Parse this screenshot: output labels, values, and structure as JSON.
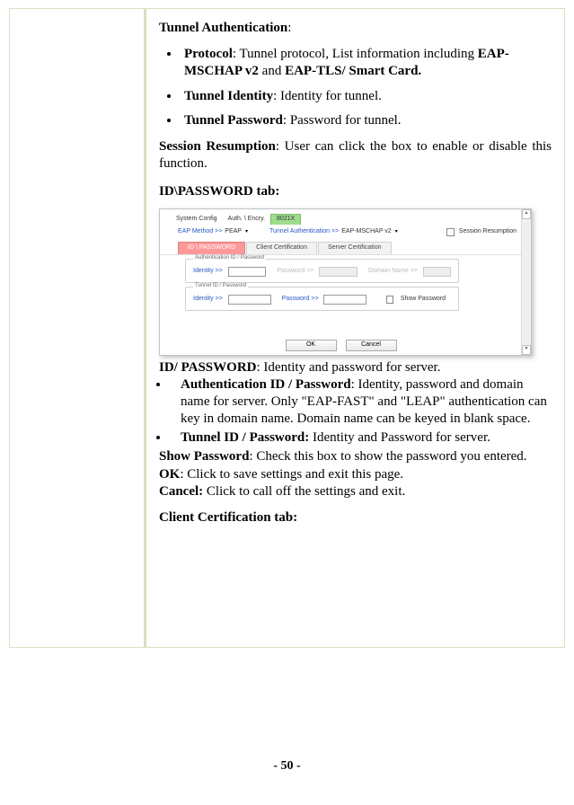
{
  "tunnel_auth": {
    "head": "Tunnel Authentication",
    "protocol_label": "Protocol",
    "protocol_desc_part1": ": Tunnel protocol, List information including ",
    "protocol_val1": "EAP-MSCHAP v2",
    "protocol_and": " and ",
    "protocol_val2": "EAP-TLS/ Smart Card.",
    "identity_label": "Tunnel Identity",
    "identity_desc": ": Identity for tunnel.",
    "password_label": "Tunnel Password",
    "password_desc": ": Password for tunnel."
  },
  "session_resumption": {
    "label": "Session Resumption",
    "desc": ": User can click the box to enable or disable this function."
  },
  "idpw": {
    "tab_head": "ID\\PASSWORD tab:",
    "head_label": "ID/ PASSWORD",
    "head_desc": ": Identity and password for server.",
    "auth_label": "Authentication ID / Password",
    "auth_desc": ": Identity, password and domain name for server. Only \"EAP-FAST\" and \"LEAP\" authentication can key in domain name. Domain name can be keyed in blank space.",
    "tun_label": "Tunnel ID / Password:",
    "tun_desc": " Identity and Password for server.",
    "showpw_label": "Show Password",
    "showpw_desc": ": Check this box to show the password you entered.",
    "ok_label": "OK",
    "ok_desc": ": Click to save settings and exit this page.",
    "cancel_label": "Cancel:",
    "cancel_desc": " Click to call off the settings and exit.",
    "clientcert_head": "Client Certification tab:"
  },
  "mini": {
    "tabs1": {
      "system": "System Config",
      "auth": "Auth. \\ Encry.",
      "x": "8021X"
    },
    "eap_lbl": "EAP Method >>",
    "eap_val": "PEAP",
    "tun_lbl": "Tunnel Authentication >>",
    "tun_val": "EAP-MSCHAP v2",
    "sess": "Session Resumption",
    "tabs2": {
      "idpw": "ID \\ PASSWORD",
      "client": "Client Certification",
      "server": "Server Certification"
    },
    "grp1": "Authentication ID / Password",
    "grp2": "Tunnel ID / Password",
    "identity": "Identity >>",
    "password": "Password >>",
    "domain": "Domain Name >>",
    "show": "Show Password",
    "ok": "OK",
    "cancel": "Cancel"
  },
  "page": "- 50 -"
}
